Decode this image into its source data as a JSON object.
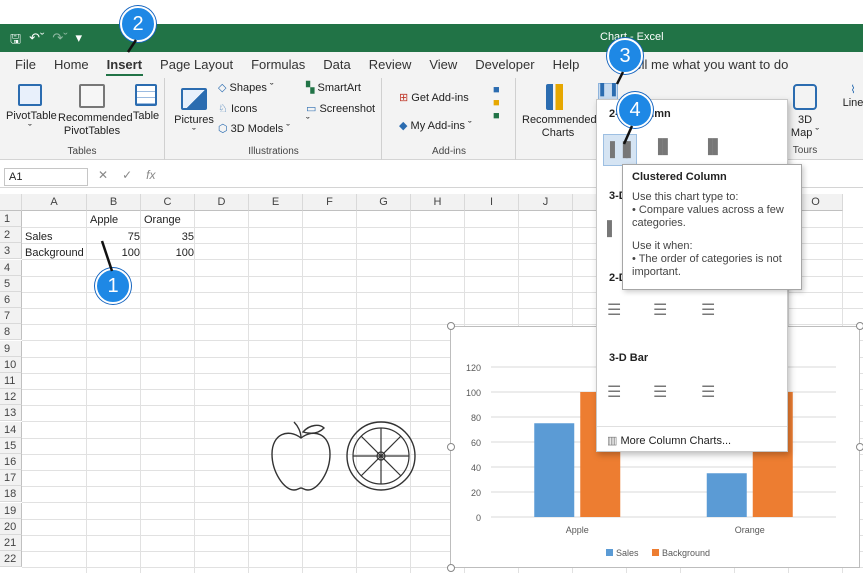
{
  "window": {
    "title": "Chart - Excel"
  },
  "tabs": [
    "File",
    "Home",
    "Insert",
    "Page Layout",
    "Formulas",
    "Data",
    "Review",
    "View",
    "Developer",
    "Help"
  ],
  "active_tab": "Insert",
  "tell_me": "Tell me what you want to do",
  "ribbon": {
    "pivottable": "PivotTable",
    "recommended_pivot": "Recommended PivotTables",
    "table": "Table",
    "tables_group": "Tables",
    "pictures": "Pictures",
    "shapes": "Shapes",
    "icons": "Icons",
    "models": "3D Models",
    "smartart": "SmartArt",
    "screenshot": "Screenshot",
    "illustrations_group": "Illustrations",
    "get_addins": "Get Add-ins",
    "my_addins": "My Add-ins",
    "addins_group": "Add-ins",
    "recommended_charts": "Recommended Charts",
    "map3d": "3D Map",
    "tours_group": "Tours",
    "line": "Line"
  },
  "namebox": "A1",
  "columns": [
    "A",
    "B",
    "C",
    "D",
    "E",
    "F",
    "G",
    "H",
    "I",
    "J",
    "",
    "",
    "",
    "",
    "O"
  ],
  "rows": [
    "1",
    "2",
    "3",
    "4",
    "5",
    "6",
    "7",
    "8",
    "9",
    "10",
    "11",
    "12",
    "13",
    "14",
    "15",
    "16",
    "17",
    "18",
    "19",
    "20",
    "21",
    "22"
  ],
  "cells": {
    "b1": "Apple",
    "c1": "Orange",
    "a2": "Sales",
    "b2": "75",
    "c2": "35",
    "a3": "Background",
    "b3": "100",
    "c3": "100"
  },
  "dropdown": {
    "col2d": "2-D Column",
    "col3d": "3-D",
    "bar2d": "2-D",
    "bar3d": "3-D Bar",
    "more": "More Column Charts..."
  },
  "tooltip": {
    "title": "Clustered Column",
    "line1": "Use this chart type to:",
    "line2": "• Compare values across a few categories.",
    "line3": "Use it when:",
    "line4": "• The order of categories is not important."
  },
  "badges": [
    "1",
    "2",
    "3",
    "4"
  ],
  "chart_data": {
    "type": "bar",
    "categories": [
      "Apple",
      "Orange"
    ],
    "series": [
      {
        "name": "Sales",
        "values": [
          75,
          35
        ],
        "color": "#5b9bd5"
      },
      {
        "name": "Background",
        "values": [
          100,
          100
        ],
        "color": "#ed7d31"
      }
    ],
    "ylim": [
      0,
      120
    ],
    "yticks": [
      "0",
      "20",
      "40",
      "60",
      "80",
      "100",
      "120"
    ],
    "legend": "bottom"
  }
}
